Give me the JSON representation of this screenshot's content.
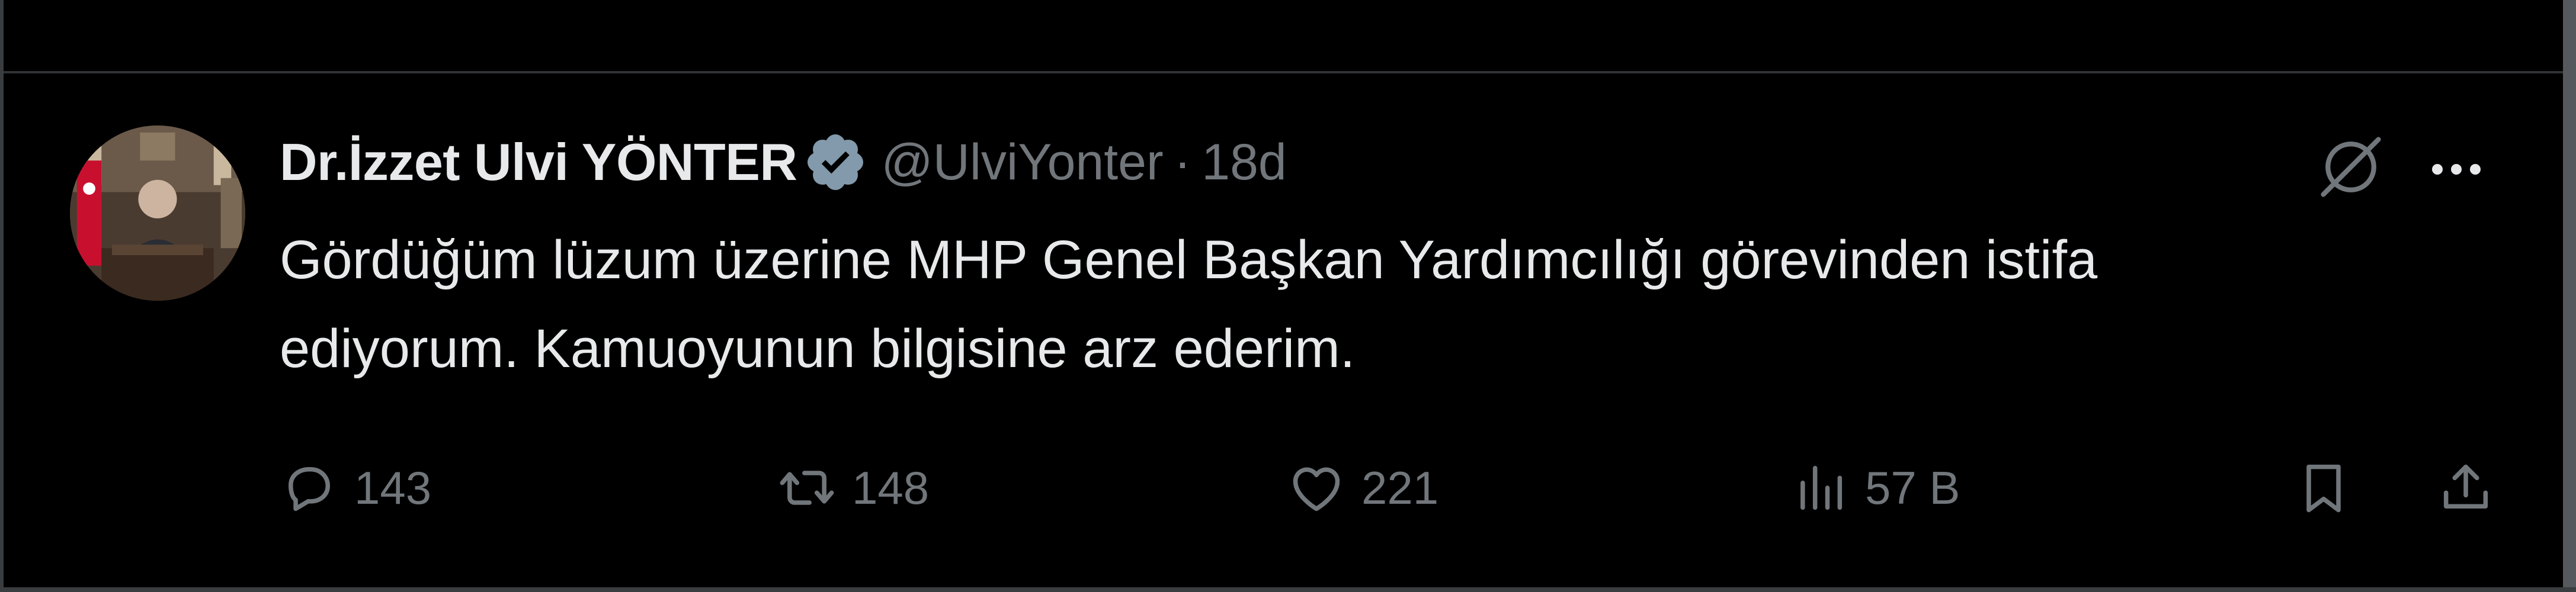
{
  "previous_tweet": {
    "link_fragment": "_ _ _ _ _ _ _"
  },
  "tweet": {
    "author": {
      "display_name": "Dr.İzzet Ulvi YÖNTER",
      "handle": "@UlviYonter",
      "verified_icon": "verified-badge-icon"
    },
    "separator": "·",
    "time": "18d",
    "text_line1": "Gördüğüm lüzum üzerine MHP Genel Başkan Yardımcılığı görevinden istifa",
    "text_line2": "ediyorum. Kamuoyunun bilgisine arz ederim.",
    "header_icons": [
      "grok-icon",
      "more-icon"
    ],
    "actions": {
      "replies": "143",
      "retweets": "148",
      "likes": "221",
      "views": "57 B"
    },
    "colors": {
      "background": "#000000",
      "text": "#e7e9ea",
      "secondary": "#71767b",
      "divider": "#2f3336",
      "verified_badge": "#829aab"
    }
  }
}
